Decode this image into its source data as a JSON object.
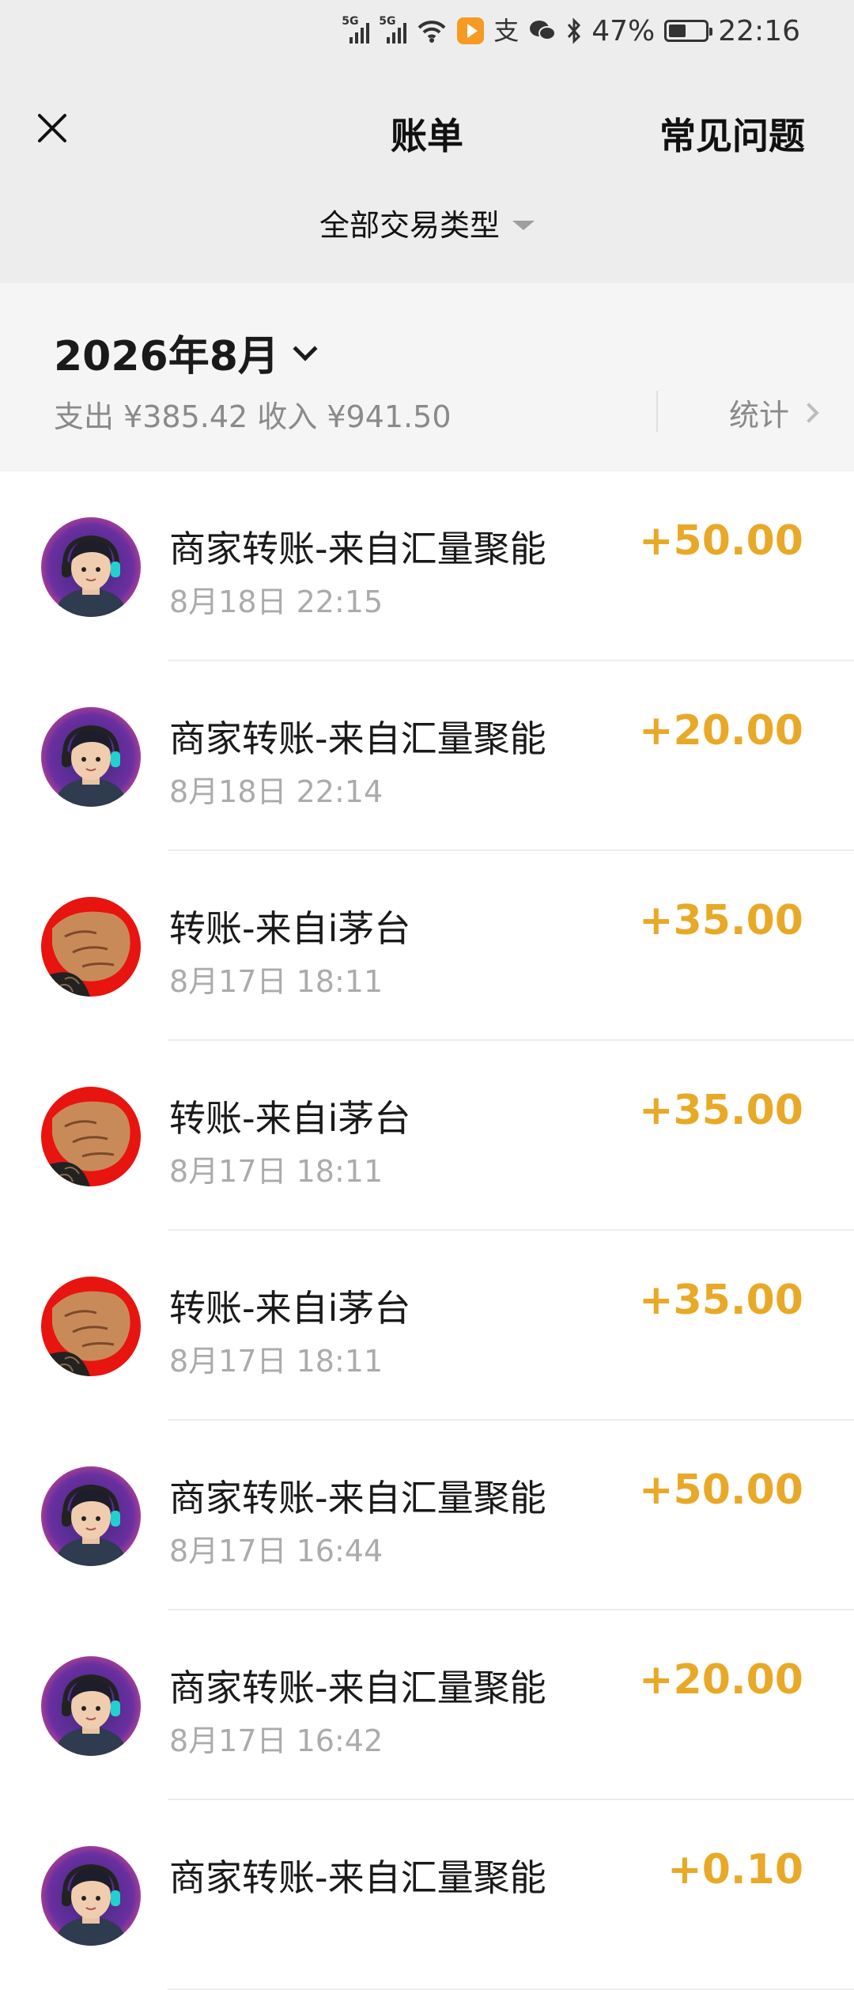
{
  "status_bar": {
    "network_1": "5G",
    "network_2": "5G",
    "battery": "47%",
    "battery_level": 0.47,
    "time": "22:16",
    "icons": [
      "signal-icon",
      "signal-icon",
      "wifi-icon",
      "video-app-icon",
      "alipay-icon",
      "wechat-icon",
      "bluetooth-icon",
      "battery-icon"
    ]
  },
  "header": {
    "title": "账单",
    "faq_label": "常见问题",
    "filter_label": "全部交易类型"
  },
  "summary": {
    "month": "2026年8月",
    "totals": "支出 ¥385.42 收入 ¥941.50",
    "stats_label": "统计"
  },
  "transactions": [
    {
      "title": "商家转账-来自汇量聚能",
      "time": "8月18日 22:15",
      "amount": "+50.00",
      "avatar": "boy"
    },
    {
      "title": "商家转账-来自汇量聚能",
      "time": "8月18日 22:14",
      "amount": "+20.00",
      "avatar": "boy"
    },
    {
      "title": "转账-来自i茅台",
      "time": "8月17日 18:11",
      "amount": "+35.00",
      "avatar": "red"
    },
    {
      "title": "转账-来自i茅台",
      "time": "8月17日 18:11",
      "amount": "+35.00",
      "avatar": "red"
    },
    {
      "title": "转账-来自i茅台",
      "time": "8月17日 18:11",
      "amount": "+35.00",
      "avatar": "red"
    },
    {
      "title": "商家转账-来自汇量聚能",
      "time": "8月17日 16:44",
      "amount": "+50.00",
      "avatar": "boy"
    },
    {
      "title": "商家转账-来自汇量聚能",
      "time": "8月17日 16:42",
      "amount": "+20.00",
      "avatar": "boy"
    },
    {
      "title": "商家转账-来自汇量聚能",
      "time": "",
      "amount": "+0.10",
      "avatar": "boy"
    }
  ],
  "colors": {
    "amount": "#e8a928",
    "header_bg": "#ededed",
    "summary_bg": "#f5f5f5"
  }
}
